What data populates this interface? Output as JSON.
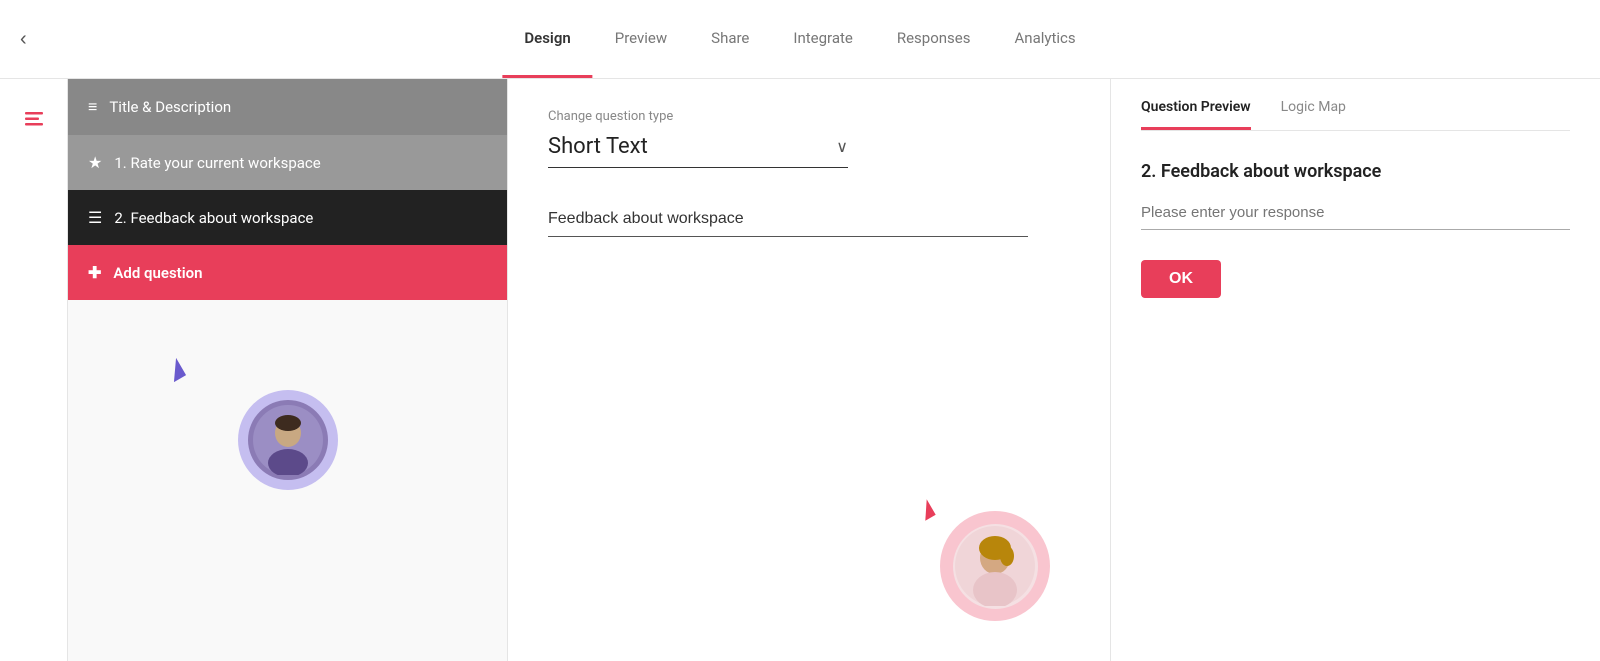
{
  "topnav": {
    "back_label": "‹",
    "tabs": [
      {
        "id": "design",
        "label": "Design",
        "active": true
      },
      {
        "id": "preview",
        "label": "Preview",
        "active": false
      },
      {
        "id": "share",
        "label": "Share",
        "active": false
      },
      {
        "id": "integrate",
        "label": "Integrate",
        "active": false
      },
      {
        "id": "responses",
        "label": "Responses",
        "active": false
      },
      {
        "id": "analytics",
        "label": "Analytics",
        "active": false
      }
    ]
  },
  "sidebar": {
    "items": [
      {
        "id": "title-desc",
        "label": "Title & Description",
        "icon": "≡",
        "style": "title-desc"
      },
      {
        "id": "q1",
        "label": "1. Rate your current workspace",
        "icon": "★",
        "style": "q1"
      },
      {
        "id": "q2",
        "label": "2. Feedback about workspace",
        "icon": "☰",
        "style": "q2"
      },
      {
        "id": "add-q",
        "label": "Add question",
        "icon": "✚",
        "style": "add-q"
      }
    ]
  },
  "middle": {
    "change_type_label": "Change question type",
    "type_selector_value": "Short Text",
    "chevron": "∨",
    "question_input_value": "Feedback about workspace"
  },
  "right_panel": {
    "tabs": [
      {
        "id": "question-preview",
        "label": "Question Preview",
        "active": true
      },
      {
        "id": "logic-map",
        "label": "Logic Map",
        "active": false
      }
    ],
    "preview_question_title": "2. Feedback about workspace",
    "preview_placeholder": "Please enter your response",
    "ok_label": "OK"
  }
}
